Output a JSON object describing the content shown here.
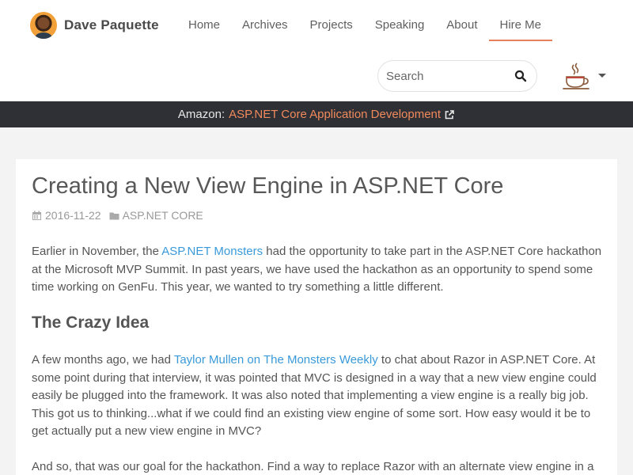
{
  "site": {
    "name": "Dave Paquette"
  },
  "nav": {
    "items": [
      {
        "label": "Home"
      },
      {
        "label": "Archives"
      },
      {
        "label": "Projects"
      },
      {
        "label": "Speaking"
      },
      {
        "label": "About"
      },
      {
        "label": "Hire Me",
        "active": true
      }
    ]
  },
  "search": {
    "placeholder": "Search",
    "value": ""
  },
  "promo": {
    "prefix": "Amazon:",
    "link": "ASP.NET Core Application Development"
  },
  "post": {
    "title": "Creating a New View Engine in ASP.NET Core",
    "date": "2016-11-22",
    "category": "ASP.NET CORE",
    "p1": {
      "before": "Earlier in November, the ",
      "link": "ASP.NET Monsters",
      "after": " had the opportunity to take part in the ASP.NET Core hackathon at the Microsoft MVP Summit. In past years, we have used the hackathon as an opportunity to spend some time working on GenFu. This year, we wanted to try something a little different."
    },
    "heading": "The Crazy Idea",
    "p2": {
      "before": "A few months ago, we had ",
      "link": "Taylor Mullen on The Monsters Weekly",
      "after": " to chat about Razor in ASP.NET Core. At some point during that interview, it was pointed that MVC is designed in a way that a new view engine could easily be plugged into the framework. It was also noted that implementing a view engine is a really big job. This got us to thinking...what if we could find an existing view engine of some sort. How easy would it be to get actually put a new view engine in MVC?"
    },
    "p3": {
      "text": "And so, that was our goal for the hackathon. Find a way to replace Razor with an alternate view engine in a"
    }
  },
  "colors": {
    "accent": "#e8805c",
    "link": "#3a9ad9",
    "promo_bg": "#2e3035",
    "page_bg": "#f3f3f3"
  },
  "icons": {
    "search": "search-icon",
    "cup": "coffee-cup-icon",
    "external": "external-link-icon",
    "calendar": "calendar-icon",
    "folder": "folder-icon"
  }
}
